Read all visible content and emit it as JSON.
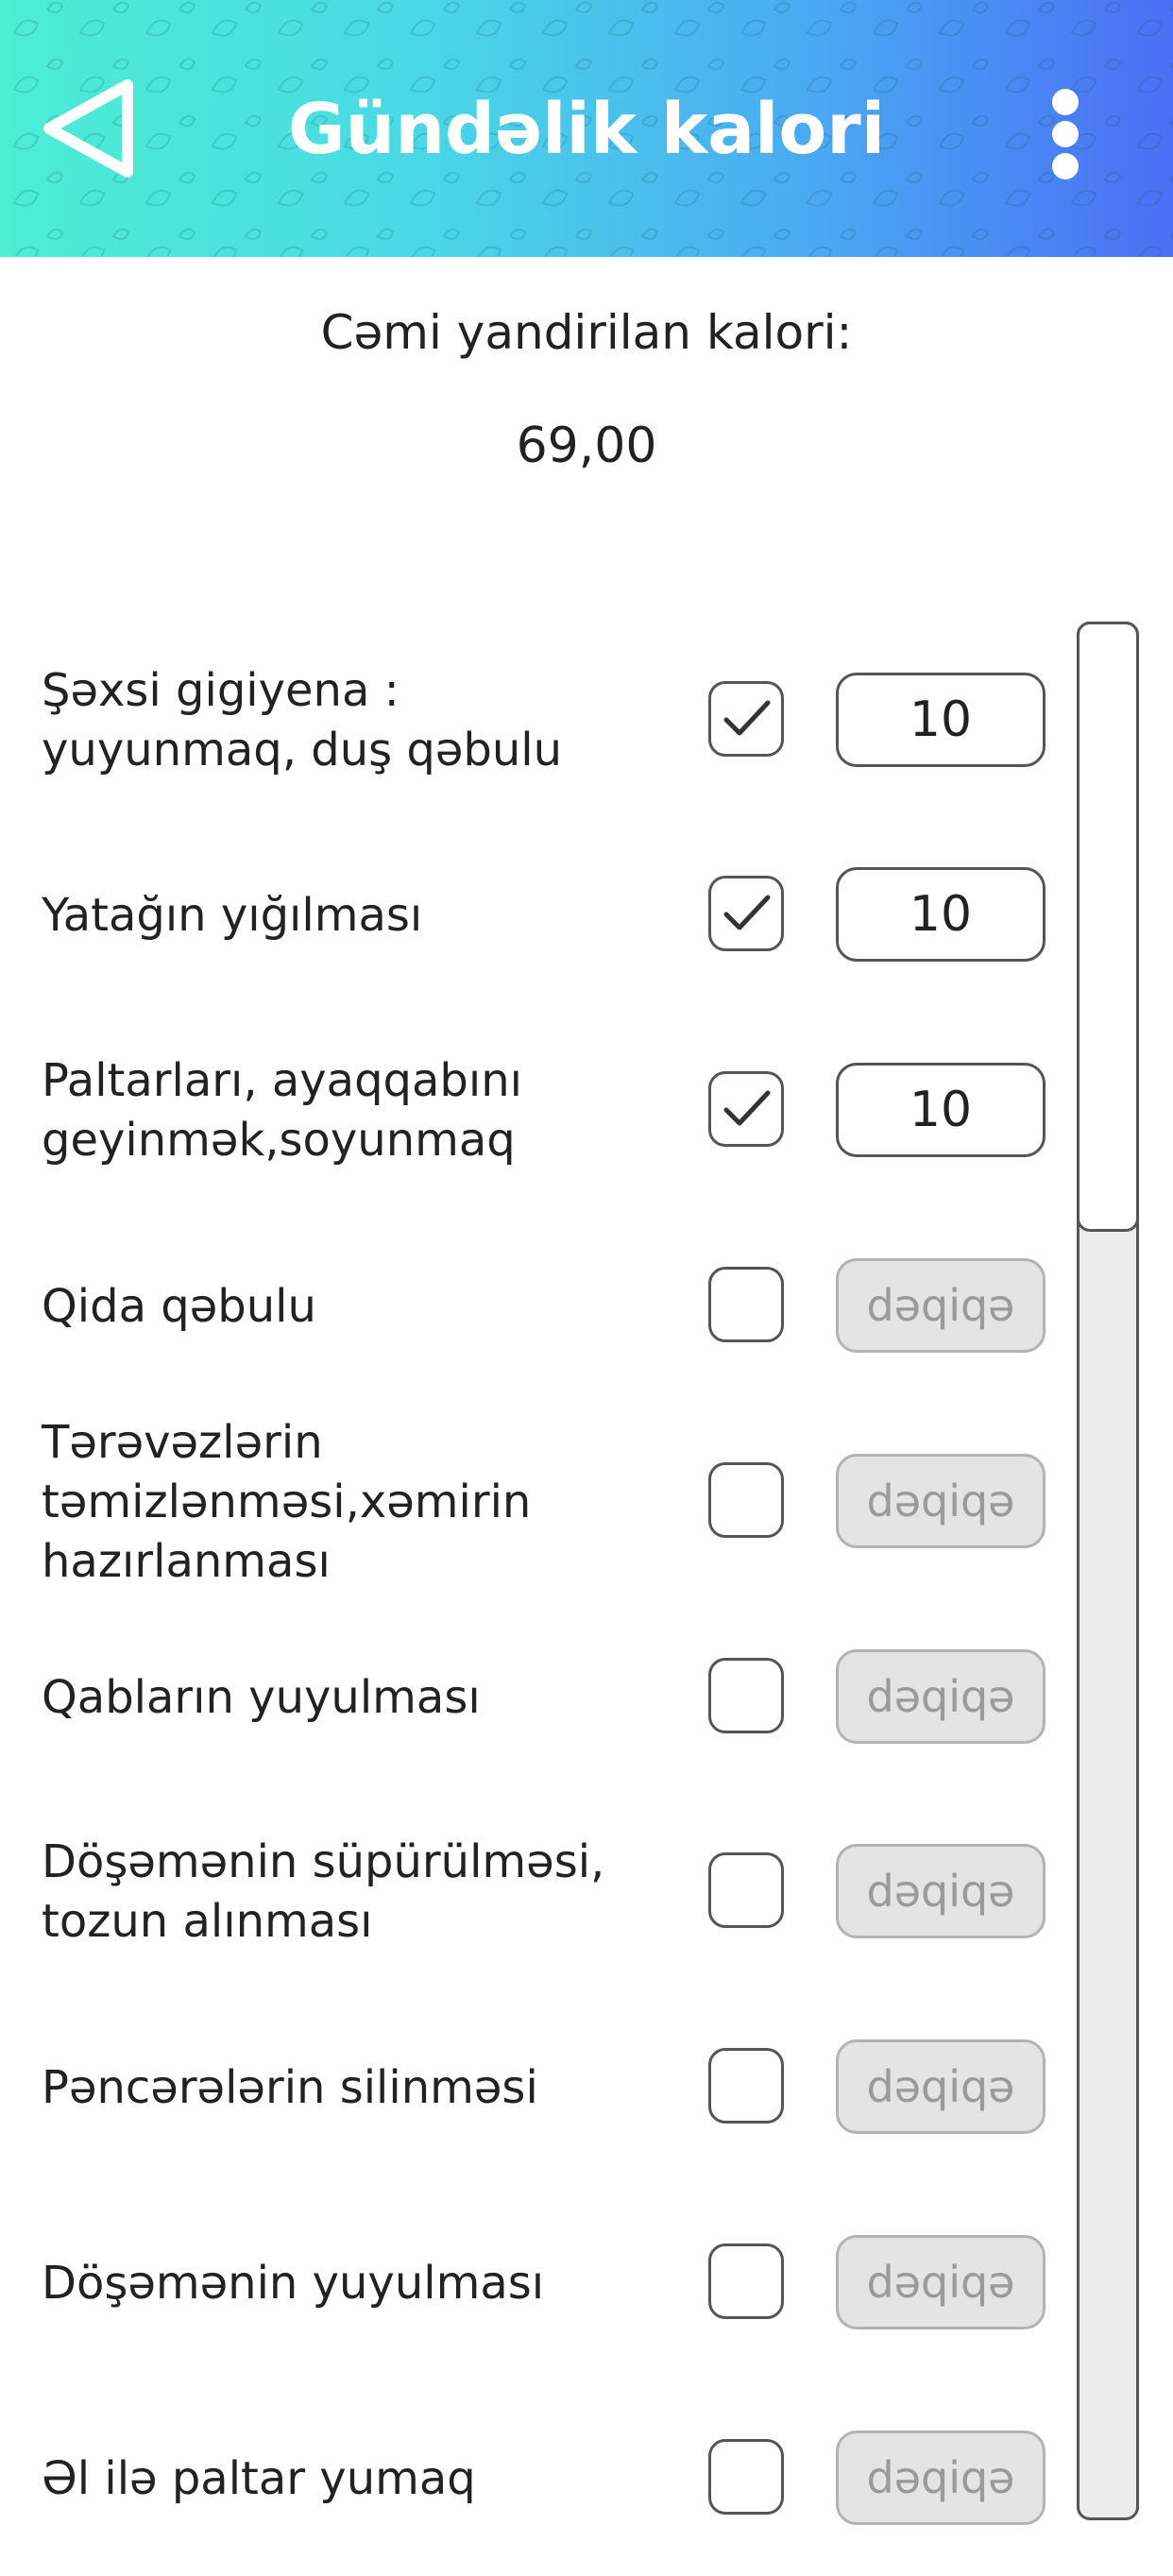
{
  "header": {
    "title": "Gündəlik kalori",
    "back_icon": "back-triangle-icon",
    "menu_icon": "more-vertical-icon",
    "gradient_start": "#4deed2",
    "gradient_end": "#4b6ef5"
  },
  "summary": {
    "label": "Cəmi yandirilan kalori:",
    "value": "69,00"
  },
  "minutes_placeholder": "dəqiqə",
  "activities": [
    {
      "label": "Şəxsi gigiyena  :\nyuyunmaq, duş qəbulu",
      "checked": true,
      "minutes": "10"
    },
    {
      "label": "Yatağın yığılması",
      "checked": true,
      "minutes": "10"
    },
    {
      "label": "Paltarları, ayaqqabını\ngeyinmək,soyunmaq",
      "checked": true,
      "minutes": "10"
    },
    {
      "label": "Qida qəbulu",
      "checked": false,
      "minutes": ""
    },
    {
      "label": "Tərəvəzlərin\ntəmizlənməsi,xəmirin\nhazırlanması",
      "checked": false,
      "minutes": ""
    },
    {
      "label": "Qabların yuyulması",
      "checked": false,
      "minutes": ""
    },
    {
      "label": "Döşəmənin süpürülməsi,\ntozun alınması",
      "checked": false,
      "minutes": ""
    },
    {
      "label": "Pəncərələrin silinməsi",
      "checked": false,
      "minutes": ""
    },
    {
      "label": "Döşəmənin yuyulması",
      "checked": false,
      "minutes": ""
    },
    {
      "label": "Əl ilə paltar yumaq",
      "checked": false,
      "minutes": ""
    }
  ]
}
